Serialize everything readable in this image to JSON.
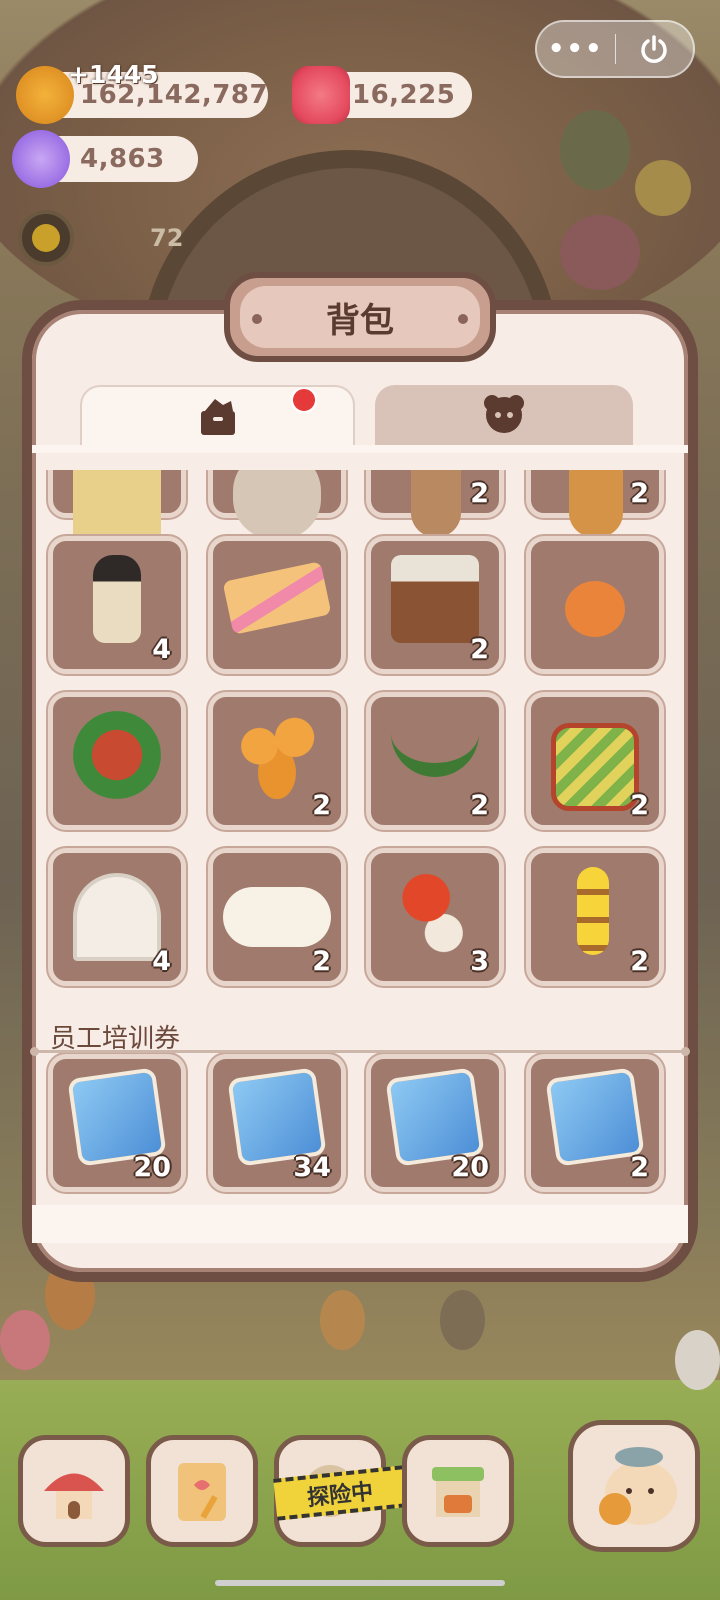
{
  "resources": {
    "gain": "+1445",
    "coins": "162,142,787",
    "candles": "16,225",
    "gems": "4,863",
    "level_value": "72"
  },
  "panel": {
    "title": "背包",
    "tabs": [
      {
        "icon": "bag-icon",
        "active": true,
        "has_badge": true
      },
      {
        "icon": "character-icon",
        "active": false,
        "has_badge": false
      }
    ]
  },
  "items_partial_row": [
    {
      "name": "crafts-slot",
      "count": ""
    },
    {
      "name": "tea-set",
      "count": ""
    },
    {
      "name": "pot",
      "count": "2"
    },
    {
      "name": "vase",
      "count": "2"
    }
  ],
  "items": [
    {
      "name": "anubis-statue",
      "count": "4"
    },
    {
      "name": "biscuit-sandwich",
      "count": ""
    },
    {
      "name": "writing-desk",
      "count": "2"
    },
    {
      "name": "carrot-pot",
      "count": ""
    },
    {
      "name": "christmas-sofa",
      "count": ""
    },
    {
      "name": "gingerbread-men",
      "count": "2"
    },
    {
      "name": "christmas-garland",
      "count": "2"
    },
    {
      "name": "striped-bed",
      "count": "2"
    },
    {
      "name": "white-headboard",
      "count": "4"
    },
    {
      "name": "fluffy-rug",
      "count": "2"
    },
    {
      "name": "berry-tree-rabbit",
      "count": "3"
    },
    {
      "name": "lantern-string",
      "count": "2"
    }
  ],
  "section": {
    "title": "员工培训券"
  },
  "vouchers": [
    {
      "name": "spatula-voucher",
      "count": "20"
    },
    {
      "name": "fist-voucher",
      "count": "34"
    },
    {
      "name": "book-voucher",
      "count": "20"
    },
    {
      "name": "glasses-voucher",
      "count": "2"
    }
  ],
  "bottom_nav": {
    "explore_label": "探险中",
    "items": [
      "mushroom-house",
      "notebook",
      "explore",
      "shop-stall",
      "fish-mascot"
    ]
  },
  "colors": {
    "panel_bg": "#f7ece6",
    "panel_border": "#6e4e42",
    "slot_bg": "#a07a6c",
    "badge_red": "#e53a3a"
  }
}
